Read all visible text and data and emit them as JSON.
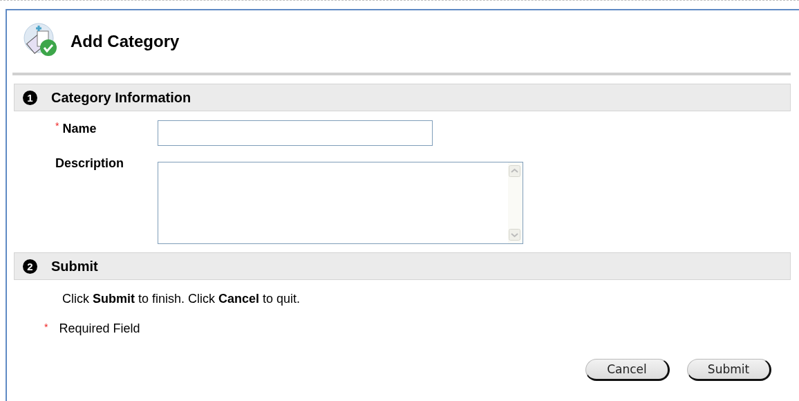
{
  "page": {
    "title": "Add Category"
  },
  "sections": [
    {
      "number": "1",
      "title": "Category Information"
    },
    {
      "number": "2",
      "title": "Submit"
    }
  ],
  "fields": [
    {
      "kind": "text",
      "label": "Name",
      "required": true,
      "required_mark": "*"
    },
    {
      "kind": "textarea",
      "label": "Description",
      "required": false
    }
  ],
  "instructions": "Click **Submit** to finish. Click **Cancel** to quit.",
  "legend": {
    "mark": "*",
    "text": "Required Field"
  },
  "buttons": [
    "Cancel",
    "Submit"
  ]
}
